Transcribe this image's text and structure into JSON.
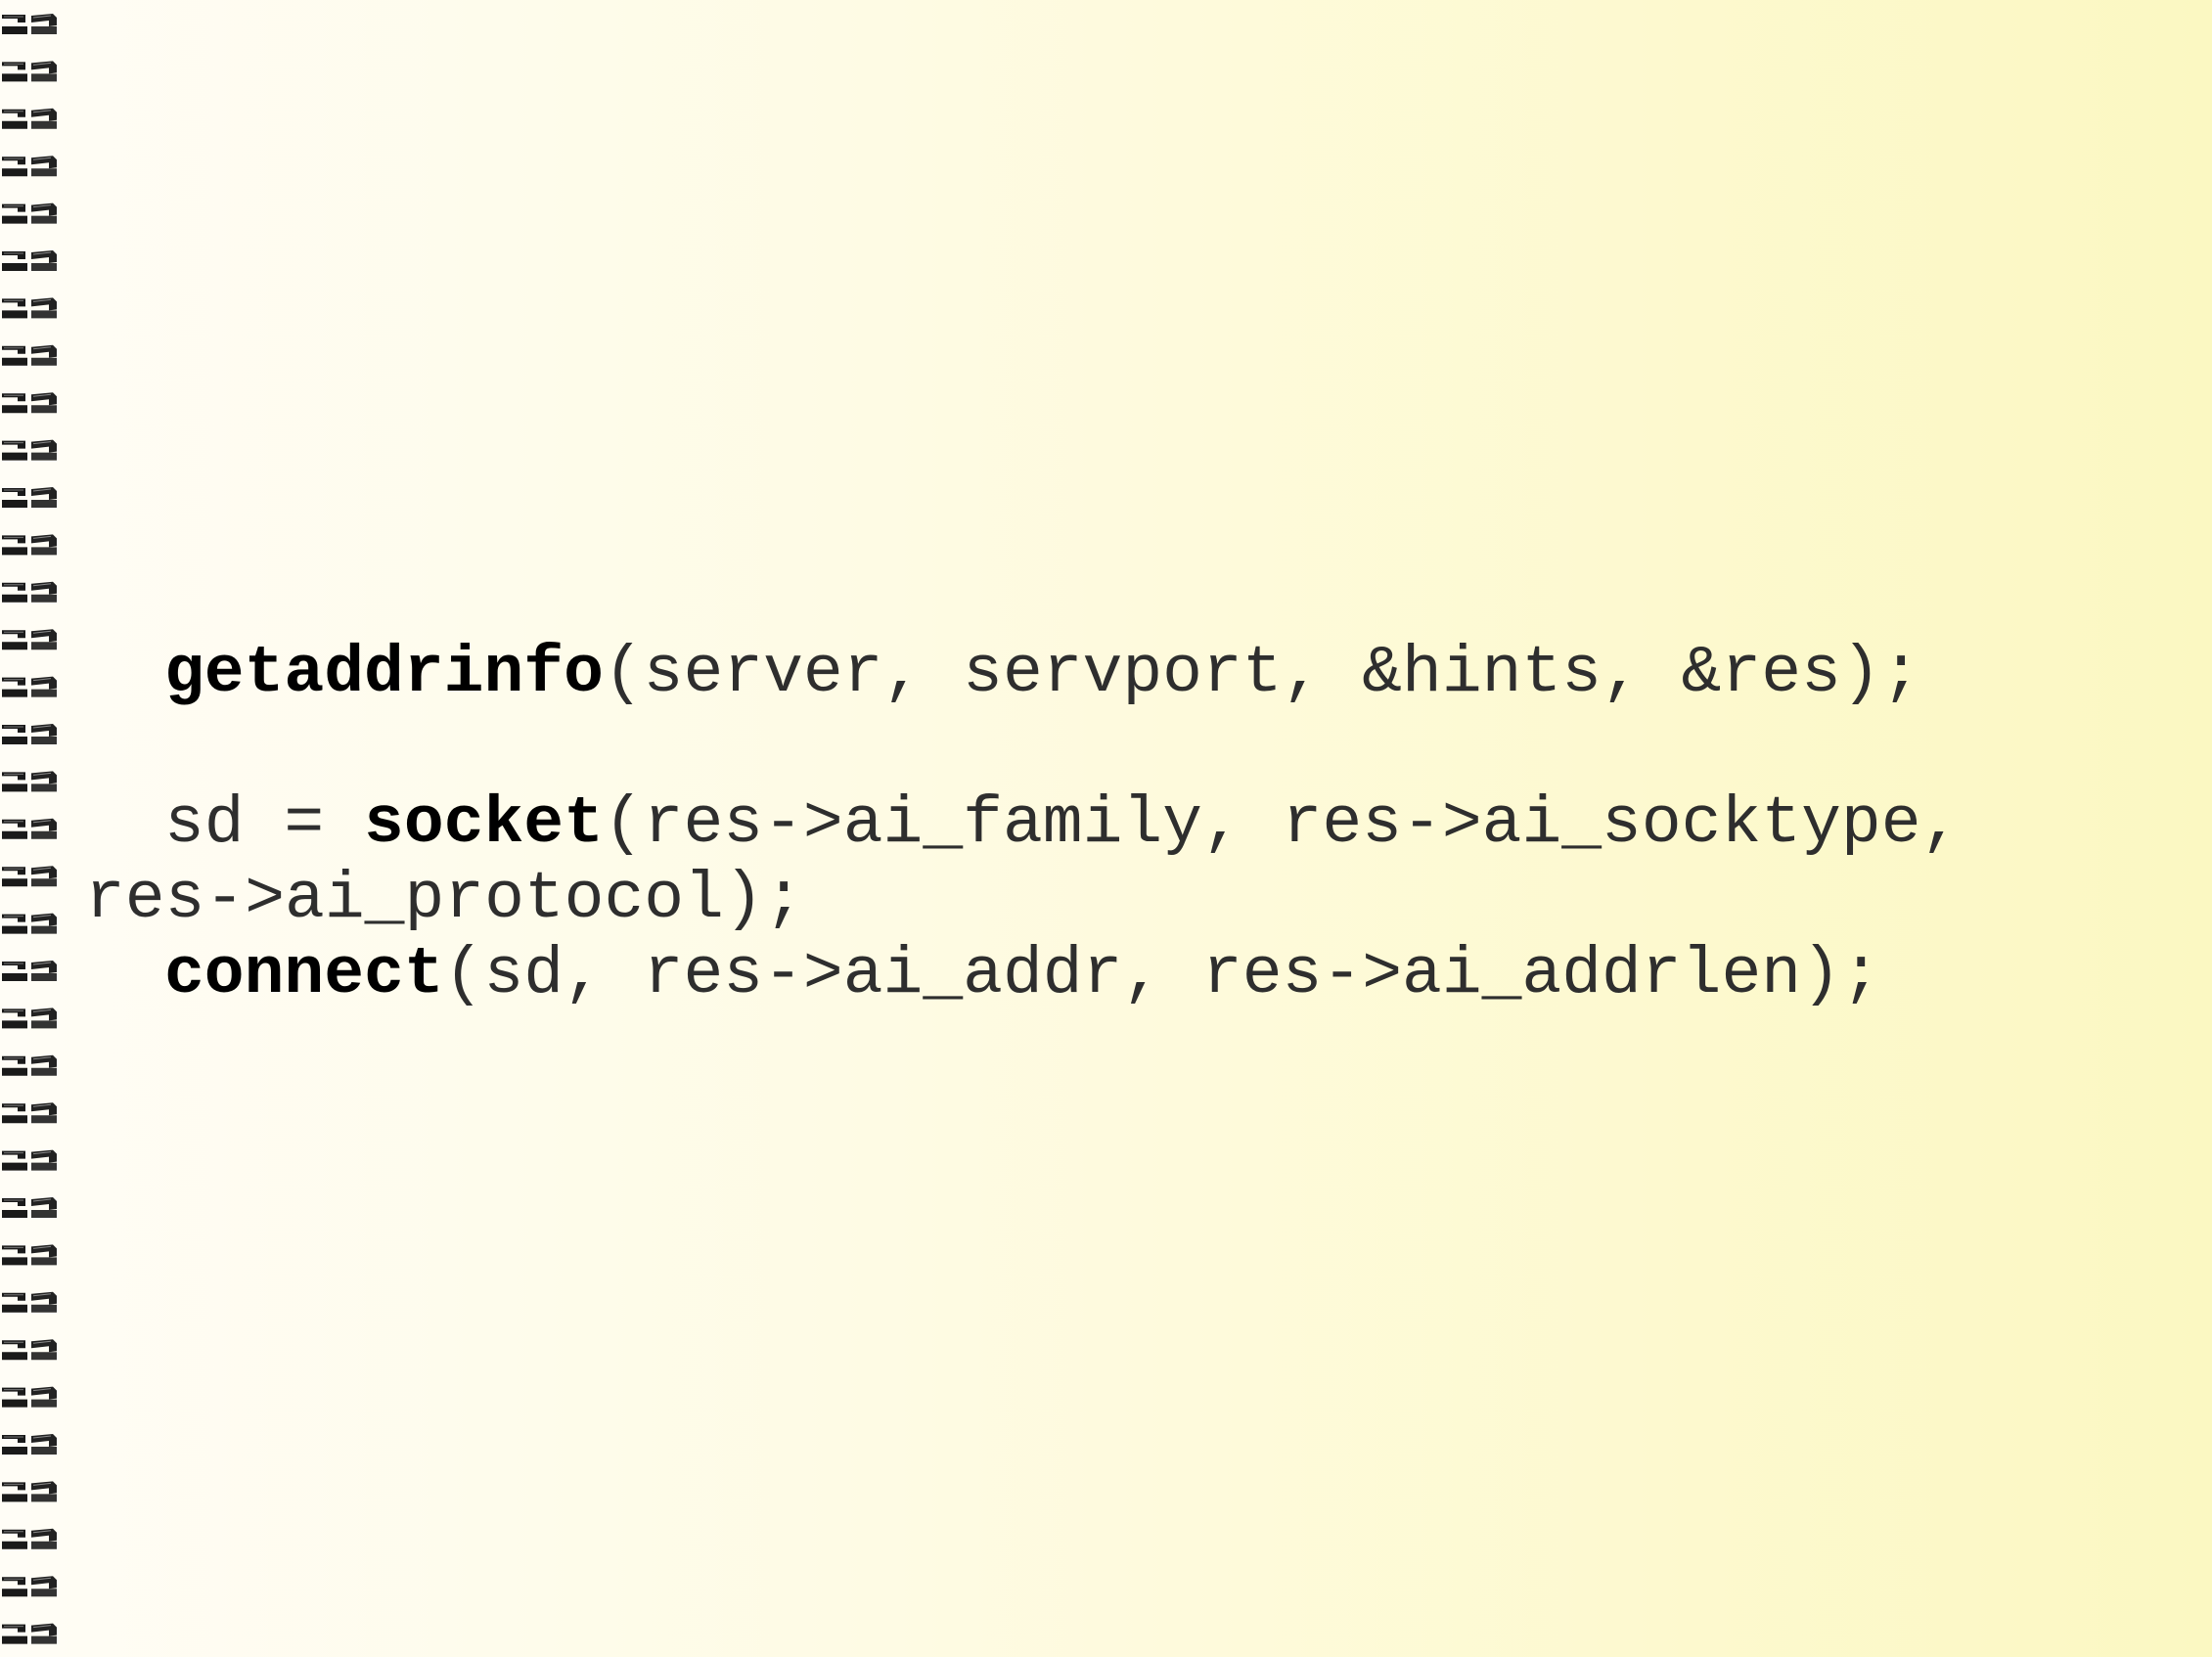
{
  "code": {
    "line1": {
      "fn": "getaddrinfo",
      "args": "(server, servport, &hints, &res);"
    },
    "line2": {
      "prefix": "sd = ",
      "fn": "socket",
      "args": "(res->ai_family, res->ai_socktype,"
    },
    "line2_wrap": "res->ai_protocol);",
    "line3": {
      "fn": "connect",
      "args": "(sd, res->ai_addr, res->ai_addrlen);"
    }
  },
  "colors": {
    "background_left": "#fffdf6",
    "background_right": "#fbf8c2",
    "text": "#2e2e2e",
    "keyword": "#000000"
  },
  "decoration": {
    "binding": "spiral-binding-icon"
  }
}
